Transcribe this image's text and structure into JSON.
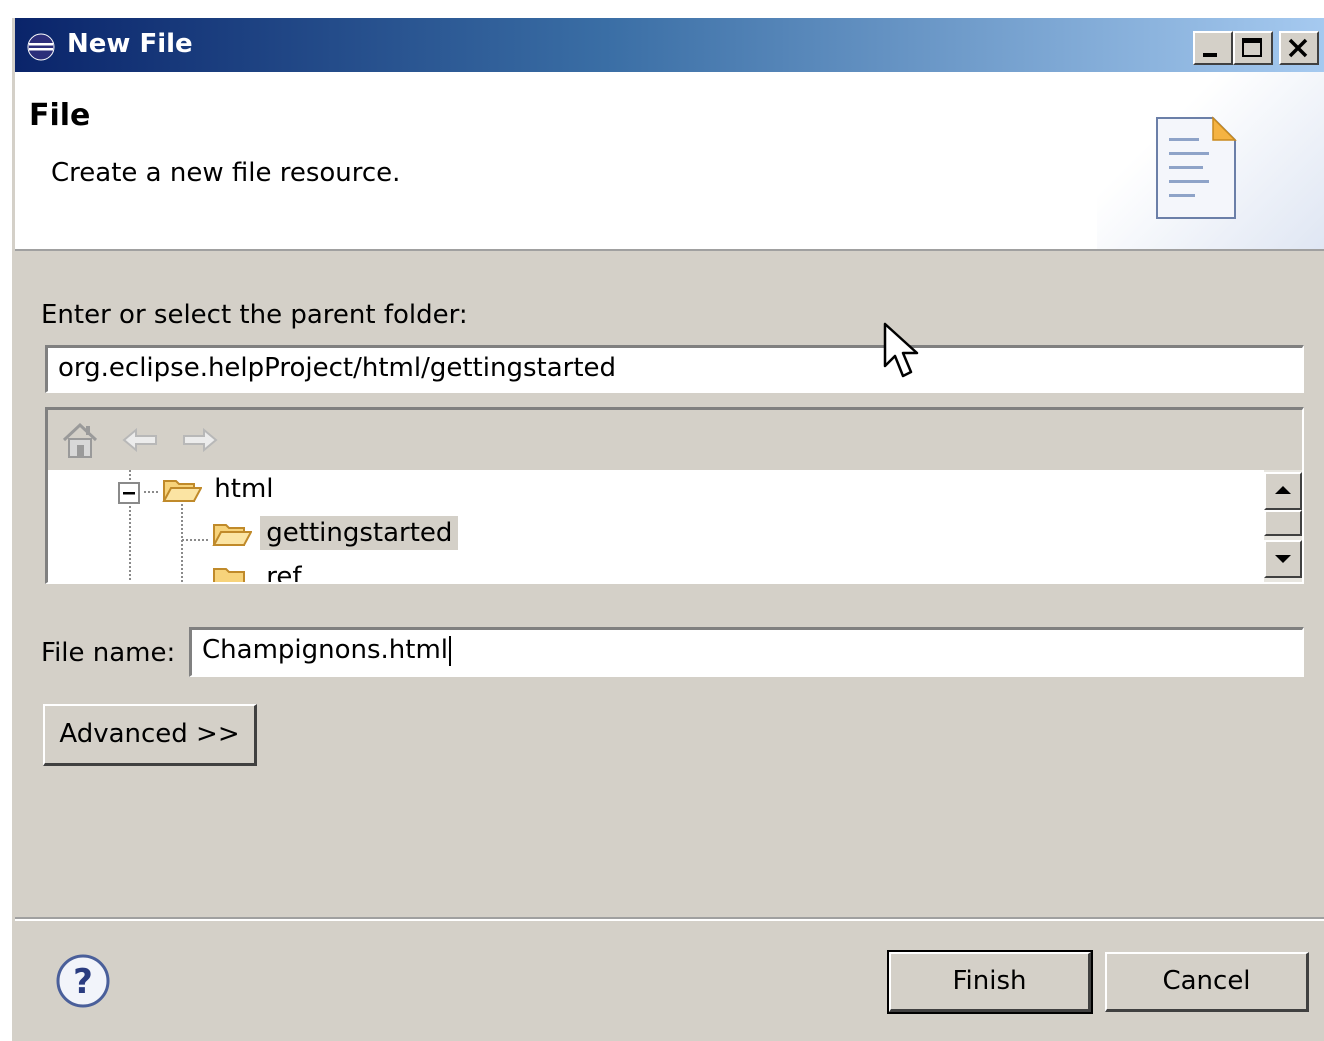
{
  "window": {
    "title": "New File"
  },
  "header": {
    "title": "File",
    "description": "Create a new file resource."
  },
  "parent_folder": {
    "label": "Enter or select the parent folder:",
    "value": "org.eclipse.helpProject/html/gettingstarted"
  },
  "tree": {
    "items": [
      {
        "label": "html",
        "expanded": true
      },
      {
        "label": "gettingstarted",
        "selected": true
      },
      {
        "label": "ref"
      }
    ]
  },
  "file_name": {
    "label": "File name:",
    "value": "Champignons.html"
  },
  "buttons": {
    "advanced": "Advanced >>",
    "finish": "Finish",
    "cancel": "Cancel"
  },
  "colors": {
    "title_start": "#0a246a",
    "title_end": "#a6caf0",
    "face": "#d4d0c8",
    "folder": "#f0b74a"
  }
}
